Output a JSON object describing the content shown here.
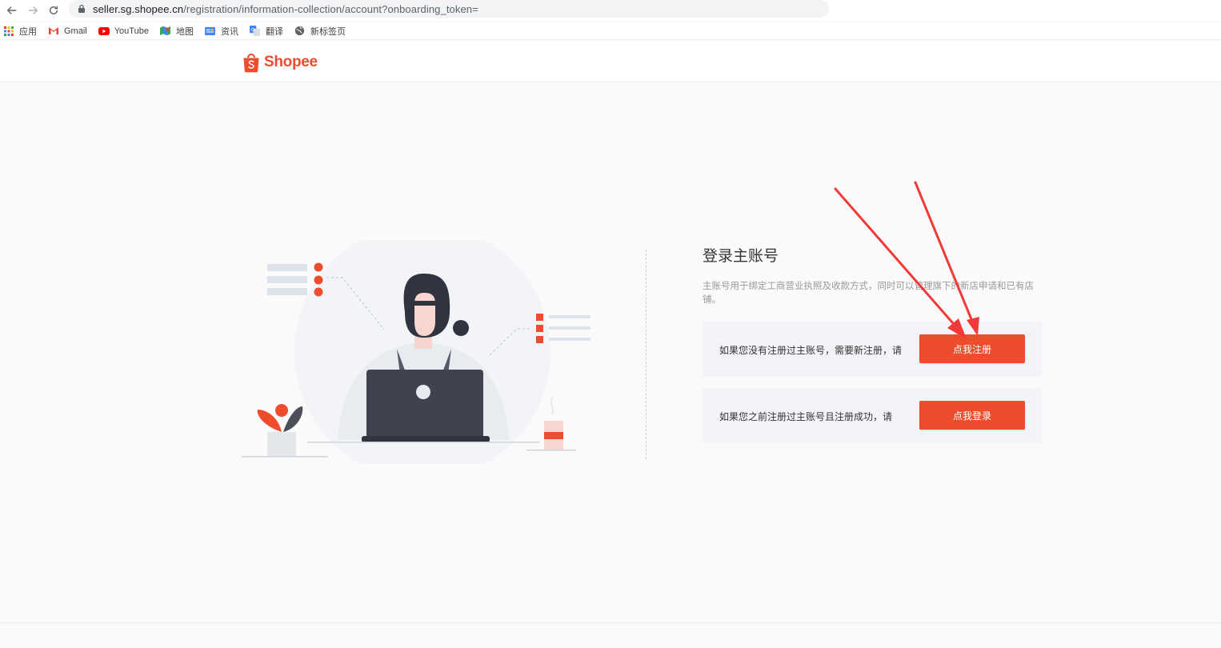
{
  "browser": {
    "url_host": "seller.sg.shopee.cn",
    "url_path": "/registration/information-collection/account?onboarding_token="
  },
  "bookmarks": [
    {
      "label": "应用",
      "icon": "apps-grid-icon"
    },
    {
      "label": "Gmail",
      "icon": "gmail-icon"
    },
    {
      "label": "YouTube",
      "icon": "youtube-icon"
    },
    {
      "label": "地图",
      "icon": "maps-icon"
    },
    {
      "label": "资讯",
      "icon": "news-icon"
    },
    {
      "label": "翻译",
      "icon": "translate-icon"
    },
    {
      "label": "新标签页",
      "icon": "globe-icon"
    }
  ],
  "header": {
    "brand": "Shopee"
  },
  "panel": {
    "title": "登录主账号",
    "description": "主账号用于绑定工商营业执照及收款方式，同时可以管理旗下的新店申请和已有店铺。",
    "options": [
      {
        "text": "如果您没有注册过主账号，需要新注册，请",
        "button": "点我注册"
      },
      {
        "text": "如果您之前注册过主账号且注册成功，请",
        "button": "点我登录"
      }
    ]
  },
  "colors": {
    "brand": "#ee4d2d",
    "card_bg": "#f2f4f7",
    "arrow": "#f03a3a"
  }
}
